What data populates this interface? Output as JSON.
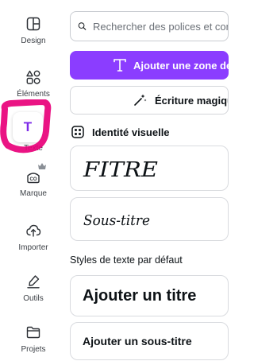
{
  "sidebar": {
    "items": [
      {
        "label": "Design",
        "icon": "layout-icon"
      },
      {
        "label": "Éléments",
        "icon": "shapes-icon"
      },
      {
        "label": "Texte",
        "icon": "text-icon"
      },
      {
        "label": "Marque",
        "icon": "brand-icon"
      },
      {
        "label": "Importer",
        "icon": "cloud-upload-icon"
      },
      {
        "label": "Outils",
        "icon": "pen-tool-icon"
      },
      {
        "label": "Projets",
        "icon": "folder-icon"
      }
    ],
    "active": "Texte",
    "texte_glyph": "T"
  },
  "search": {
    "placeholder": "Rechercher des polices et combinaisons"
  },
  "buttons": {
    "add_text_box": "Ajouter une zone de texte",
    "magic_write": "Écriture magique"
  },
  "brand_kit": {
    "heading": "Identité visuelle",
    "samples": [
      "FITRE",
      "Sous-titre"
    ]
  },
  "defaults": {
    "heading": "Styles de texte par défaut",
    "title": "Ajouter un titre",
    "subtitle": "Ajouter un sous-titre"
  },
  "colors": {
    "accent": "#8b3dff",
    "highlight_pink": "#e8007a",
    "text_purple": "#7d2ae8"
  }
}
